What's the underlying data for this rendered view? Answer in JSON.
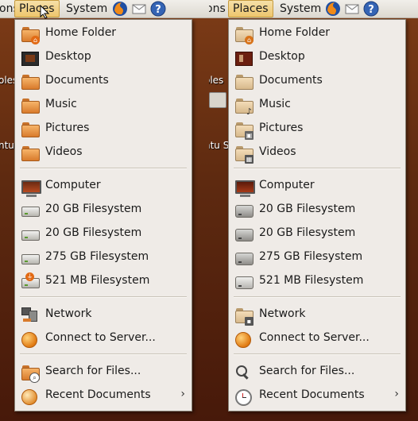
{
  "left": {
    "panel": {
      "partial_label": "ons",
      "places_label": "Places",
      "system_label": "System"
    },
    "desktop": {
      "frag1": "oles",
      "frag2": "ntu S"
    },
    "menu": {
      "group1": [
        "Home Folder",
        "Desktop",
        "Documents",
        "Music",
        "Pictures",
        "Videos"
      ],
      "group2": [
        "Computer",
        "20 GB Filesystem",
        "20 GB Filesystem",
        "275 GB Filesystem",
        "521 MB Filesystem"
      ],
      "group3": [
        "Network",
        "Connect to Server..."
      ],
      "group4": [
        "Search for Files...",
        "Recent Documents"
      ],
      "submenu_arrow": "›"
    }
  },
  "right": {
    "panel": {
      "partial_label": "ons",
      "places_label": "Places",
      "system_label": "System"
    },
    "desktop": {
      "frag1": "oles",
      "frag2": "ntu S"
    },
    "menu": {
      "group1": [
        "Home Folder",
        "Desktop",
        "Documents",
        "Music",
        "Pictures",
        "Videos"
      ],
      "group2": [
        "Computer",
        "20 GB Filesystem",
        "20 GB Filesystem",
        "275 GB Filesystem",
        "521 MB Filesystem"
      ],
      "group3": [
        "Network",
        "Connect to Server..."
      ],
      "group4": [
        "Search for Files...",
        "Recent Documents"
      ],
      "submenu_arrow": "›"
    }
  },
  "colors": {
    "panel": "#dcd8d0",
    "active": "#edc56c",
    "menu_bg": "#efebe7",
    "desktop": "#5e2a10"
  }
}
